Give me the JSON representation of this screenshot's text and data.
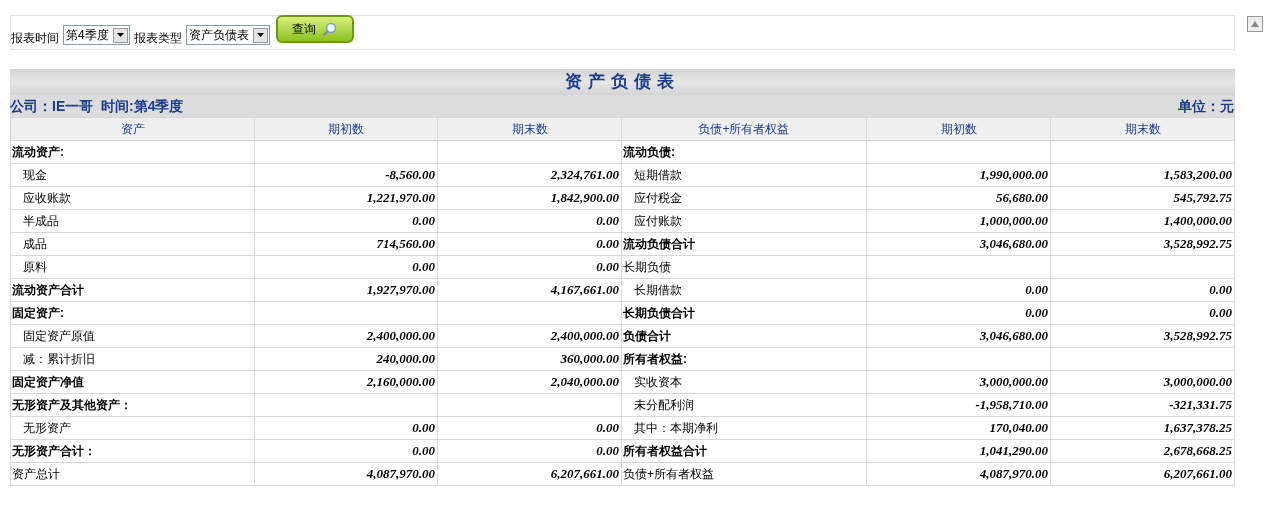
{
  "filter_bar": {
    "fields": [
      {
        "label": "报表时间",
        "value": "第4季度"
      },
      {
        "label": "报表类型",
        "value": "资产负债表"
      }
    ],
    "query_button": "查询"
  },
  "report": {
    "title": "资产负债表",
    "company_line": "公司：IE一哥  时间:第4季度",
    "unit": "单位：元",
    "columns": [
      "资产",
      "期初数",
      "期末数",
      "负债+所有者权益",
      "期初数",
      "期末数"
    ],
    "rows": [
      {
        "left": {
          "kind": "section",
          "label": "流动资产:"
        },
        "right": {
          "kind": "section",
          "label": "流动负债:"
        }
      },
      {
        "left": {
          "kind": "item",
          "label": "现金",
          "begin": "-8,560.00",
          "end": "2,324,761.00"
        },
        "right": {
          "kind": "item",
          "label": "短期借款",
          "begin": "1,990,000.00",
          "end": "1,583,200.00"
        }
      },
      {
        "left": {
          "kind": "item",
          "label": "应收账款",
          "begin": "1,221,970.00",
          "end": "1,842,900.00"
        },
        "right": {
          "kind": "item",
          "label": "应付税金",
          "begin": "56,680.00",
          "end": "545,792.75"
        }
      },
      {
        "left": {
          "kind": "item",
          "label": "半成品",
          "begin": "0.00",
          "end": "0.00"
        },
        "right": {
          "kind": "item",
          "label": "应付账款",
          "begin": "1,000,000.00",
          "end": "1,400,000.00"
        }
      },
      {
        "left": {
          "kind": "item",
          "label": "成品",
          "begin": "714,560.00",
          "end": "0.00"
        },
        "right": {
          "kind": "section",
          "label": "流动负债合计",
          "begin": "3,046,680.00",
          "end": "3,528,992.75"
        }
      },
      {
        "left": {
          "kind": "item",
          "label": "原料",
          "begin": "0.00",
          "end": "0.00"
        },
        "right": {
          "kind": "plain",
          "label": "长期负债"
        }
      },
      {
        "left": {
          "kind": "section",
          "label": "流动资产合计",
          "begin": "1,927,970.00",
          "end": "4,167,661.00"
        },
        "right": {
          "kind": "item",
          "label": "长期借款",
          "begin": "0.00",
          "end": "0.00"
        }
      },
      {
        "left": {
          "kind": "section",
          "label": "固定资产:"
        },
        "right": {
          "kind": "section",
          "label": "长期负债合计",
          "begin": "0.00",
          "end": "0.00"
        }
      },
      {
        "left": {
          "kind": "item",
          "label": "固定资产原值",
          "begin": "2,400,000.00",
          "end": "2,400,000.00"
        },
        "right": {
          "kind": "section",
          "label": "负债合计",
          "begin": "3,046,680.00",
          "end": "3,528,992.75"
        }
      },
      {
        "left": {
          "kind": "item",
          "label": "减：累计折旧",
          "begin": "240,000.00",
          "end": "360,000.00"
        },
        "right": {
          "kind": "section",
          "label": "所有者权益:"
        }
      },
      {
        "left": {
          "kind": "section",
          "label": "固定资产净值",
          "begin": "2,160,000.00",
          "end": "2,040,000.00"
        },
        "right": {
          "kind": "item",
          "label": "实收资本",
          "begin": "3,000,000.00",
          "end": "3,000,000.00"
        }
      },
      {
        "left": {
          "kind": "section",
          "label": "无形资产及其他资产："
        },
        "right": {
          "kind": "item",
          "label": "未分配利润",
          "begin": "-1,958,710.00",
          "end": "-321,331.75"
        }
      },
      {
        "left": {
          "kind": "item",
          "label": "无形资产",
          "begin": "0.00",
          "end": "0.00"
        },
        "right": {
          "kind": "item",
          "label": "其中：本期净利",
          "begin": "170,040.00",
          "end": "1,637,378.25"
        }
      },
      {
        "left": {
          "kind": "section",
          "label": "无形资产合计：",
          "begin": "0.00",
          "end": "0.00"
        },
        "right": {
          "kind": "section",
          "label": "所有者权益合计",
          "begin": "1,041,290.00",
          "end": "2,678,668.25"
        }
      },
      {
        "left": {
          "kind": "plain",
          "label": "资产总计",
          "begin": "4,087,970.00",
          "end": "6,207,661.00"
        },
        "right": {
          "kind": "plain",
          "label": "负债+所有者权益",
          "begin": "4,087,970.00",
          "end": "6,207,661.00"
        }
      }
    ]
  }
}
